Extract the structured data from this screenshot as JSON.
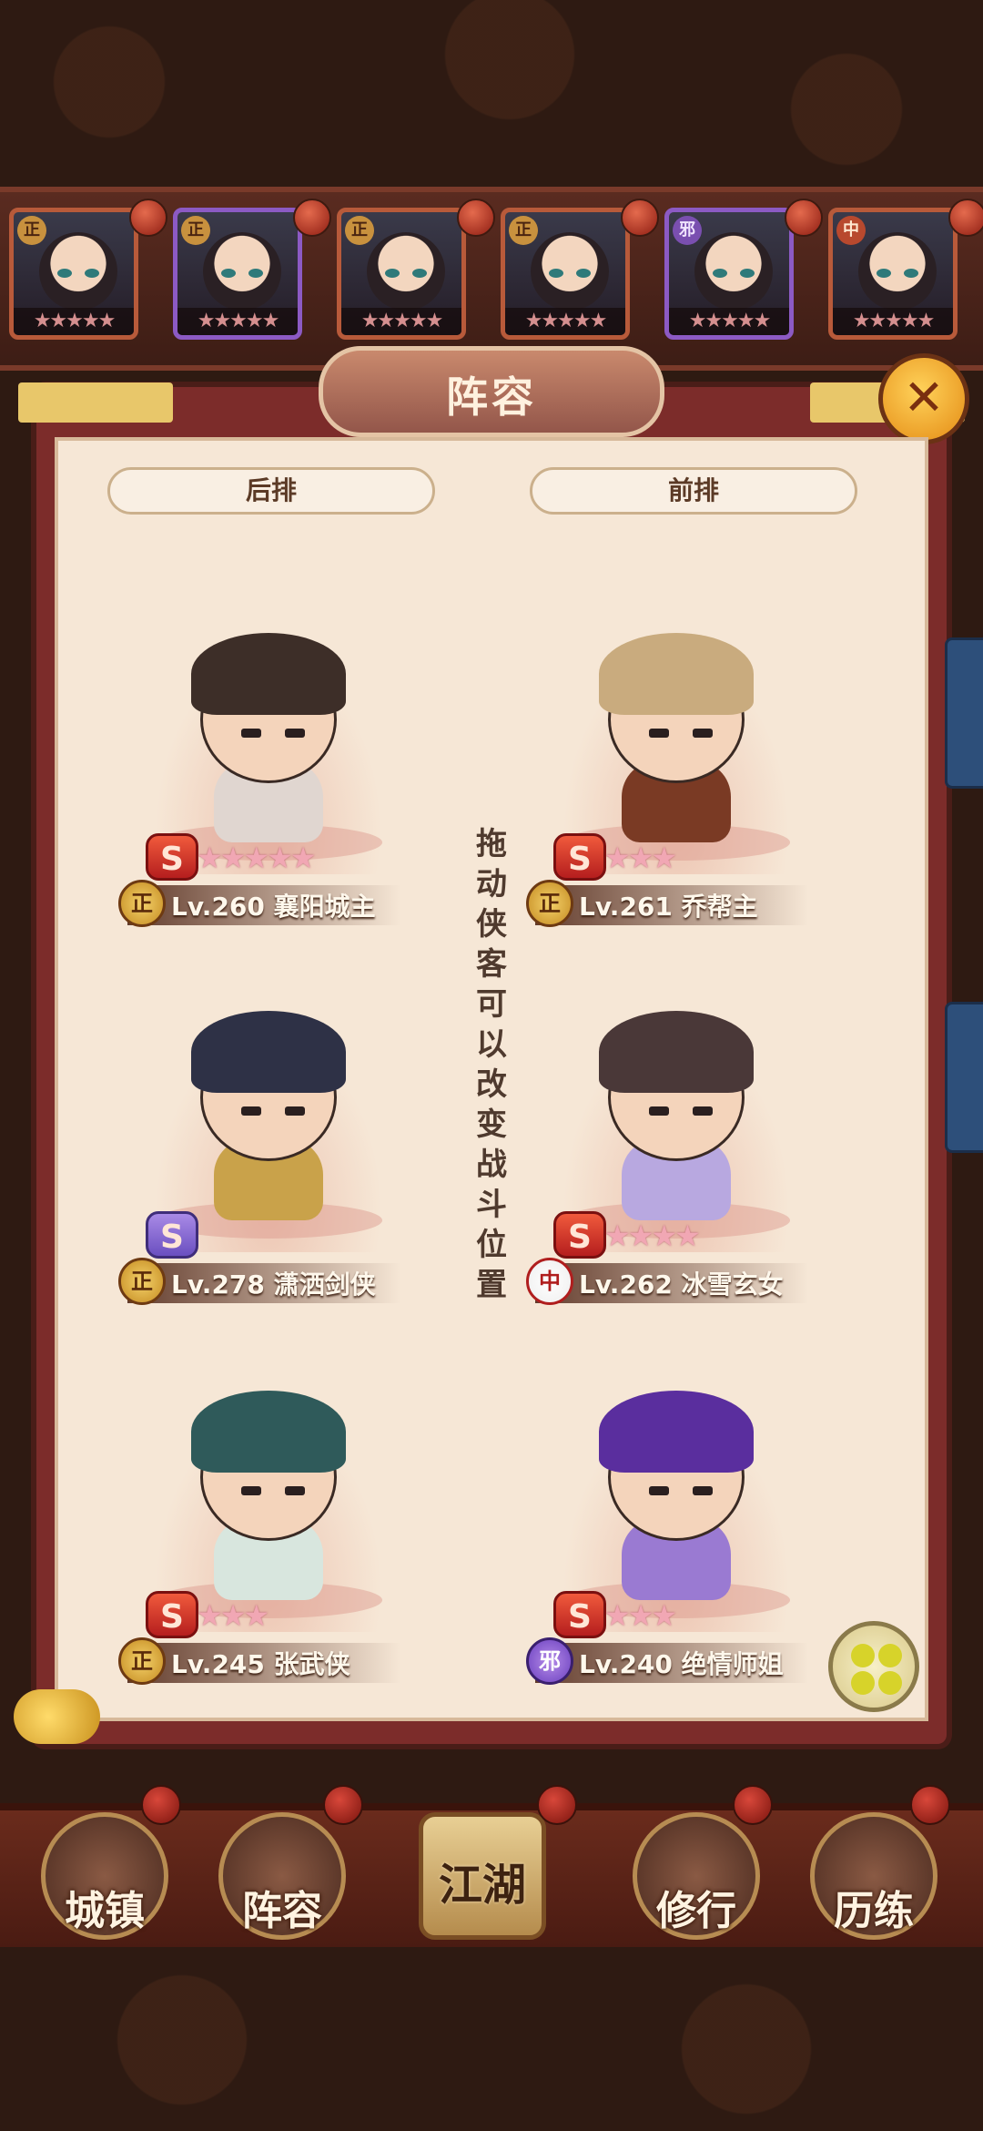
{
  "roster": [
    {
      "faction": "正",
      "style": "normal",
      "stars": "★★★★★"
    },
    {
      "faction": "正",
      "style": "purple",
      "stars": "★★★★★"
    },
    {
      "faction": "正",
      "style": "normal",
      "stars": "★★★★★"
    },
    {
      "faction": "正",
      "style": "normal",
      "stars": "★★★★★"
    },
    {
      "faction": "邪",
      "style": "purple",
      "stars": "★★★★★"
    },
    {
      "faction": "中",
      "style": "normal",
      "stars": "★★★★★"
    }
  ],
  "panel": {
    "title": "阵容",
    "close_icon": "close-icon",
    "back_row_label": "后排",
    "front_row_label": "前排",
    "instruction": "拖动侠客可以改变战斗位置"
  },
  "formation": {
    "back": [
      {
        "rank": "S",
        "stars": "★★★★★",
        "faction": "正",
        "level_text": "Lv.260 襄阳城主",
        "hair_color": "#3d2e28",
        "body_color": "#e0d6d0"
      },
      {
        "rank": "S",
        "stars": "",
        "faction": "正",
        "level_text": "Lv.278 潇洒剑侠",
        "hair_color": "#2e3146",
        "body_color": "#c9a24a",
        "rank_style": "purple"
      },
      {
        "rank": "S",
        "stars": "★★★",
        "faction": "正",
        "level_text": "Lv.245 张武侠",
        "hair_color": "#2f5a5a",
        "body_color": "#d8e6de"
      }
    ],
    "front": [
      {
        "rank": "S",
        "stars": "★★★",
        "faction": "正",
        "level_text": "Lv.261 乔帮主",
        "hair_color": "#c9ab7e",
        "body_color": "#7a3a24"
      },
      {
        "rank": "S",
        "stars": "★★★★",
        "faction": "中",
        "level_text": "Lv.262 冰雪玄女",
        "hair_color": "#4a3838",
        "body_color": "#b8a8e0"
      },
      {
        "rank": "S",
        "stars": "★★★",
        "faction": "邪",
        "level_text": "Lv.240 绝情师姐",
        "hair_color": "#5a2e9e",
        "body_color": "#9a7ad2"
      }
    ]
  },
  "bottom_nav": [
    {
      "label": "城镇",
      "icon": "town-icon"
    },
    {
      "label": "阵容",
      "icon": "formation-icon"
    },
    {
      "label": "江湖",
      "icon": "jianghu-scroll-icon"
    },
    {
      "label": "修行",
      "icon": "cultivation-icon"
    },
    {
      "label": "历练",
      "icon": "training-icon"
    }
  ],
  "colors": {
    "accent_gold": "#e8c76a",
    "panel_red": "#7c2c2a",
    "parchment": "#f6e7d6"
  }
}
